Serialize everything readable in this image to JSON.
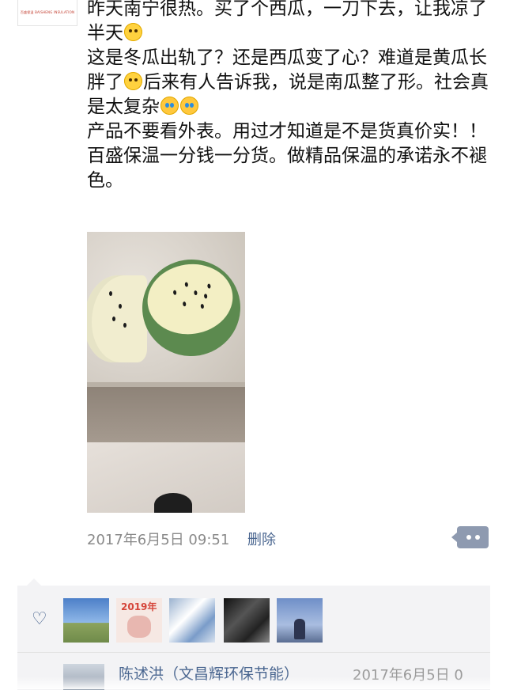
{
  "post": {
    "lines": [
      "昨天南宁很热。买了个西瓜，一刀下去，让我凉了半天",
      "这是冬瓜出轨了？还是西瓜变了心？难道是黄瓜长胖了",
      "后来有人告诉我，说是南瓜整了形。社会真是太复杂",
      "产品不要看外表。用过才知道是不是货真价实！！",
      "百盛保温一分钱一分货。做精品保温的承诺永不褪色。"
    ],
    "emoji": {
      "line1": "smile-emoji",
      "line2": "dizzy-emoji",
      "line3": [
        "laugh-cry-emoji",
        "laugh-cry-emoji"
      ]
    }
  },
  "photo": {
    "subject": "watermelon-photo"
  },
  "meta": {
    "date": "2017年6月5日 09:51",
    "delete_label": "删除",
    "more_icon": "more-dots-icon"
  },
  "likes": {
    "icon": "heart-icon",
    "avatar_count": 5,
    "avatar2_text": "2019年"
  },
  "comment": {
    "name": "陈述洪（文昌辉环保节能）",
    "time": "2017年6月5日 0"
  },
  "colors": {
    "link": "#4a6690",
    "meta": "#8a8a8a",
    "panel": "#f3f3f5",
    "more_button": "#8e9ab0"
  }
}
